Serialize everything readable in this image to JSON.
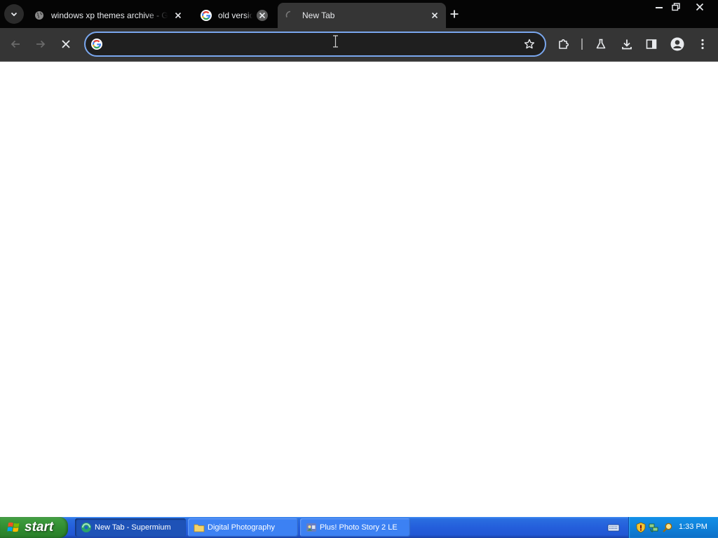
{
  "browser": {
    "tabs": [
      {
        "title": "windows xp themes archive - Goog",
        "active": false
      },
      {
        "title": "old versio",
        "active": false
      },
      {
        "title": "New Tab",
        "active": true,
        "loading": true
      }
    ],
    "omnibox": {
      "value": "",
      "placeholder": ""
    },
    "icons": {
      "tab_search": "chevron-down-icon",
      "new_tab": "plus-icon",
      "back": "back-arrow-icon",
      "forward": "forward-arrow-icon",
      "stop": "stop-icon",
      "bookmark": "star-icon",
      "extensions": "puzzle-icon",
      "labs": "flask-icon",
      "downloads": "download-icon",
      "side_panel": "side-panel-icon",
      "profile": "avatar-icon",
      "menu": "kebab-menu-icon"
    },
    "colors": {
      "frame": "#050505",
      "toolbar": "#353535",
      "focus_ring": "#7aa7ee"
    }
  },
  "taskbar": {
    "start_label": "start",
    "tasks": [
      {
        "label": "New Tab - Supermium",
        "active": true
      },
      {
        "label": "Digital Photography",
        "active": false
      },
      {
        "label": "Plus! Photo Story 2 LE",
        "active": false
      }
    ],
    "clock": "1:33 PM",
    "colors": {
      "bar": "#245edb",
      "start": "#3c9a3c",
      "tray": "#0f81d9"
    }
  }
}
